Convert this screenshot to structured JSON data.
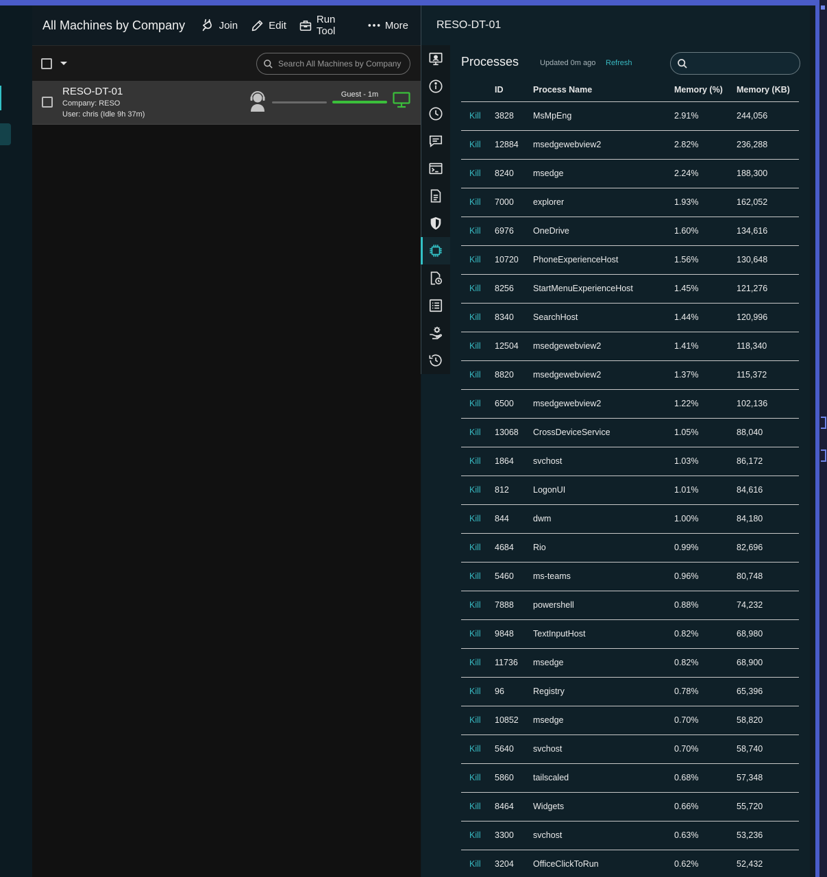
{
  "list_panel": {
    "title": "All Machines by Company",
    "toolbar": [
      {
        "label": "Join",
        "icon": "plug-icon"
      },
      {
        "label": "Edit",
        "icon": "pencil-icon"
      },
      {
        "label": "Run Tool",
        "icon": "toolbox-icon"
      },
      {
        "label": "More",
        "icon": "more-icon"
      }
    ],
    "search_placeholder": "Search All Machines by Company",
    "machine": {
      "name": "RESO-DT-01",
      "company": "Company: RESO",
      "user": "User: chris (Idle 9h 37m)",
      "guest_label": "Guest - 1m",
      "status_color": "#3bbf3b"
    }
  },
  "detail_panel": {
    "title": "RESO-DT-01",
    "side_icons": [
      "remote-desktop-icon",
      "info-icon",
      "clock-icon",
      "chat-icon",
      "terminal-icon",
      "document-icon",
      "shield-icon",
      "processor-icon",
      "file-clock-icon",
      "list-icon",
      "settings-hand-icon",
      "history-icon"
    ],
    "active_icon": "processor-icon",
    "processes": {
      "title": "Processes",
      "updated": "Updated 0m ago",
      "refresh": "Refresh",
      "columns": [
        "",
        "ID",
        "Process Name",
        "Memory (%)",
        "Memory (KB)"
      ],
      "kill_label": "Kill",
      "rows": [
        {
          "id": "3828",
          "name": "MsMpEng",
          "mem_pct": "2.91%",
          "mem_kb": "244,056"
        },
        {
          "id": "12884",
          "name": "msedgewebview2",
          "mem_pct": "2.82%",
          "mem_kb": "236,288"
        },
        {
          "id": "8240",
          "name": "msedge",
          "mem_pct": "2.24%",
          "mem_kb": "188,300"
        },
        {
          "id": "7000",
          "name": "explorer",
          "mem_pct": "1.93%",
          "mem_kb": "162,052"
        },
        {
          "id": "6976",
          "name": "OneDrive",
          "mem_pct": "1.60%",
          "mem_kb": "134,616"
        },
        {
          "id": "10720",
          "name": "PhoneExperienceHost",
          "mem_pct": "1.56%",
          "mem_kb": "130,648"
        },
        {
          "id": "8256",
          "name": "StartMenuExperienceHost",
          "mem_pct": "1.45%",
          "mem_kb": "121,276"
        },
        {
          "id": "8340",
          "name": "SearchHost",
          "mem_pct": "1.44%",
          "mem_kb": "120,996"
        },
        {
          "id": "12504",
          "name": "msedgewebview2",
          "mem_pct": "1.41%",
          "mem_kb": "118,340"
        },
        {
          "id": "8820",
          "name": "msedgewebview2",
          "mem_pct": "1.37%",
          "mem_kb": "115,372"
        },
        {
          "id": "6500",
          "name": "msedgewebview2",
          "mem_pct": "1.22%",
          "mem_kb": "102,136"
        },
        {
          "id": "13068",
          "name": "CrossDeviceService",
          "mem_pct": "1.05%",
          "mem_kb": "88,040"
        },
        {
          "id": "1864",
          "name": "svchost",
          "mem_pct": "1.03%",
          "mem_kb": "86,172"
        },
        {
          "id": "812",
          "name": "LogonUI",
          "mem_pct": "1.01%",
          "mem_kb": "84,616"
        },
        {
          "id": "844",
          "name": "dwm",
          "mem_pct": "1.00%",
          "mem_kb": "84,180"
        },
        {
          "id": "4684",
          "name": "Rio",
          "mem_pct": "0.99%",
          "mem_kb": "82,696"
        },
        {
          "id": "5460",
          "name": "ms-teams",
          "mem_pct": "0.96%",
          "mem_kb": "80,748"
        },
        {
          "id": "7888",
          "name": "powershell",
          "mem_pct": "0.88%",
          "mem_kb": "74,232"
        },
        {
          "id": "9848",
          "name": "TextInputHost",
          "mem_pct": "0.82%",
          "mem_kb": "68,980"
        },
        {
          "id": "11736",
          "name": "msedge",
          "mem_pct": "0.82%",
          "mem_kb": "68,900"
        },
        {
          "id": "96",
          "name": "Registry",
          "mem_pct": "0.78%",
          "mem_kb": "65,396"
        },
        {
          "id": "10852",
          "name": "msedge",
          "mem_pct": "0.70%",
          "mem_kb": "58,820"
        },
        {
          "id": "5640",
          "name": "svchost",
          "mem_pct": "0.70%",
          "mem_kb": "58,740"
        },
        {
          "id": "5860",
          "name": "tailscaled",
          "mem_pct": "0.68%",
          "mem_kb": "57,348"
        },
        {
          "id": "8464",
          "name": "Widgets",
          "mem_pct": "0.66%",
          "mem_kb": "55,720"
        },
        {
          "id": "3300",
          "name": "svchost",
          "mem_pct": "0.63%",
          "mem_kb": "53,236"
        },
        {
          "id": "3204",
          "name": "OfficeClickToRun",
          "mem_pct": "0.62%",
          "mem_kb": "52,432"
        }
      ]
    }
  }
}
